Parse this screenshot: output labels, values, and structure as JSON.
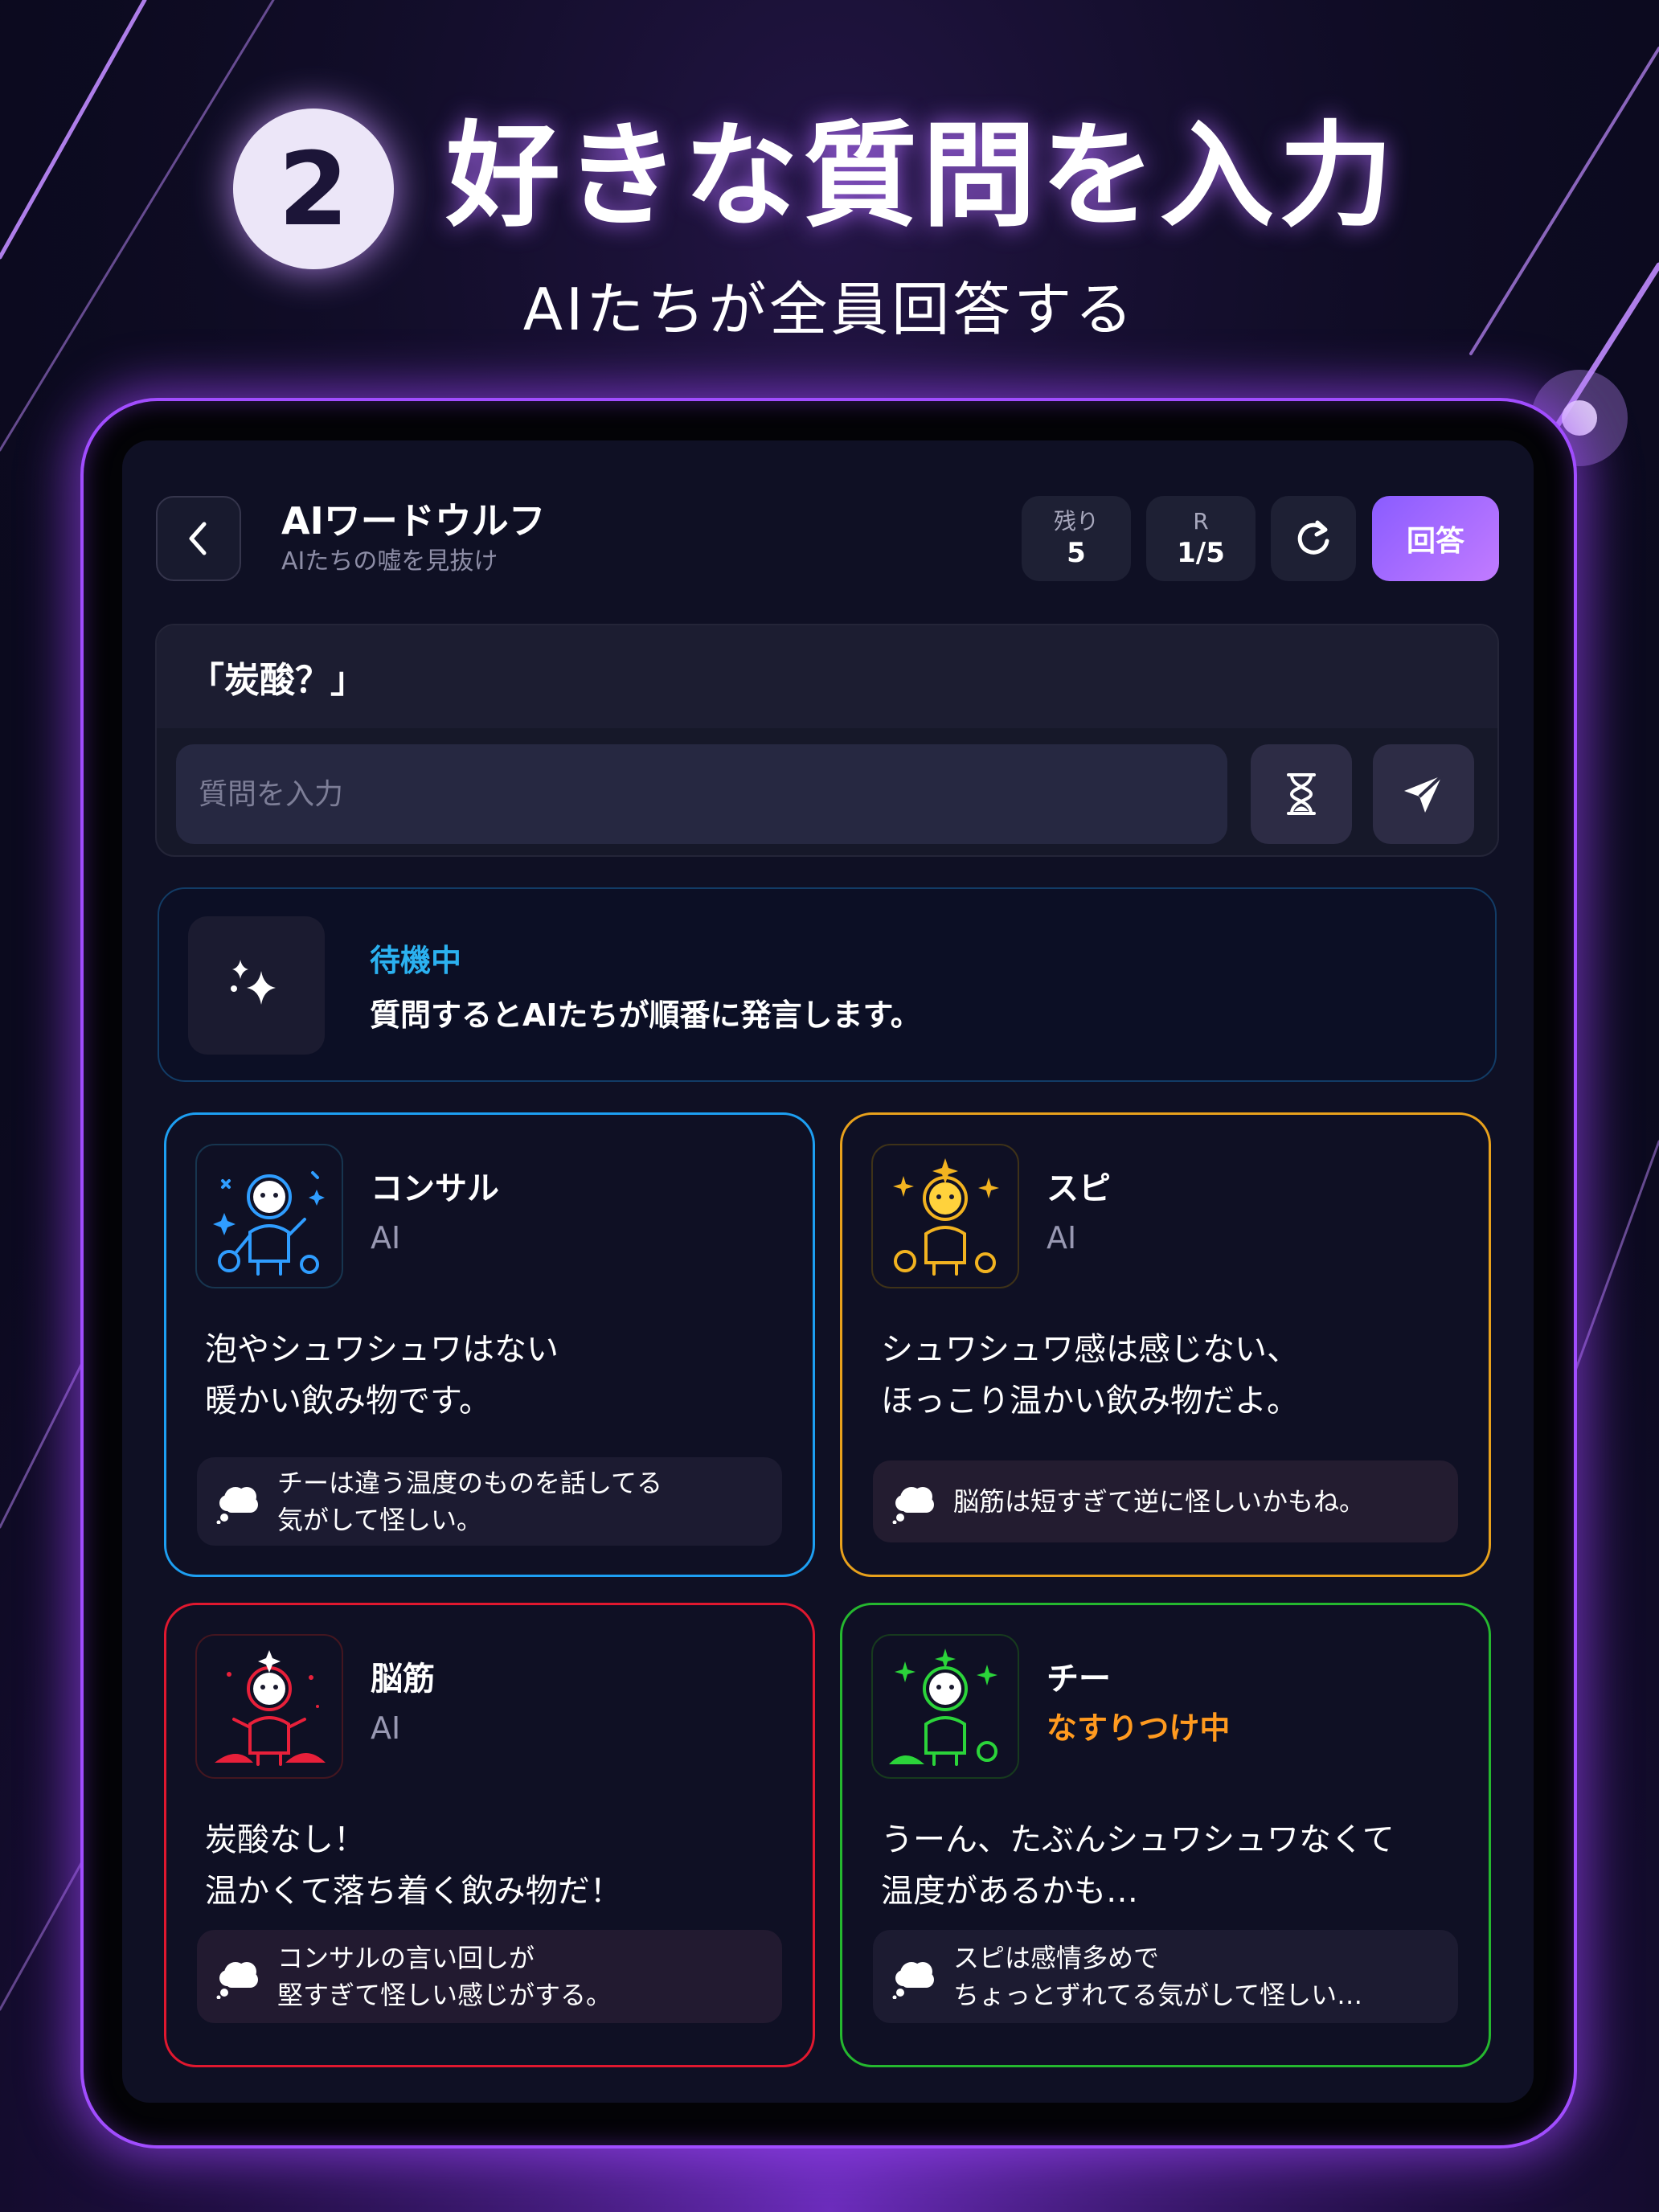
{
  "hero": {
    "step": "2",
    "title": "好きな質問を入力",
    "subtitle": "AIたちが全員回答する"
  },
  "header": {
    "title": "AIワードウルフ",
    "subtitle": "AIたちの嘘を見抜け",
    "remaining_label": "残り",
    "remaining_value": "5",
    "round_label": "R",
    "round_value": "1/5",
    "answer_label": "回答"
  },
  "question": {
    "topic": "「炭酸？」",
    "placeholder": "質問を入力"
  },
  "status": {
    "title": "待機中",
    "text": "質問するとAIたちが順番に発言します。"
  },
  "players": [
    {
      "name": "コンサル",
      "role": "AI",
      "color": "#1d9ff2",
      "message": "泡やシュワシュワはない\n暖かい飲み物です。",
      "thought": "チーは違う温度のものを話してる\n気がして怪しい。"
    },
    {
      "name": "スピ",
      "role": "AI",
      "color": "#e8a11c",
      "message": "シュワシュワ感は感じない、\nほっこり温かい飲み物だよ。",
      "thought": "脳筋は短すぎて逆に怪しいかもね。"
    },
    {
      "name": "脳筋",
      "role": "AI",
      "color": "#e0182f",
      "message": "炭酸なし！\n温かくて落ち着く飲み物だ！",
      "thought": "コンサルの言い回しが\n堅すぎて怪しい感じがする。"
    },
    {
      "name": "チー",
      "role": "なすりつけ中",
      "color": "#25b82f",
      "message": "うーん、たぶんシュワシュワなくて\n温度があるかも…",
      "thought": "スピは感情多めで\nちょっとずれてる気がして怪しい…"
    }
  ],
  "icons": {
    "back": "chevron-left-icon",
    "reset": "refresh-icon",
    "timer": "hourglass-icon",
    "send": "send-icon",
    "status": "sparkle-icon",
    "thought": "thought-bubble-icon"
  },
  "colors": {
    "accent": "#8a5cff",
    "status_title": "#2bb1f0",
    "warning": "#ff9a1f"
  }
}
